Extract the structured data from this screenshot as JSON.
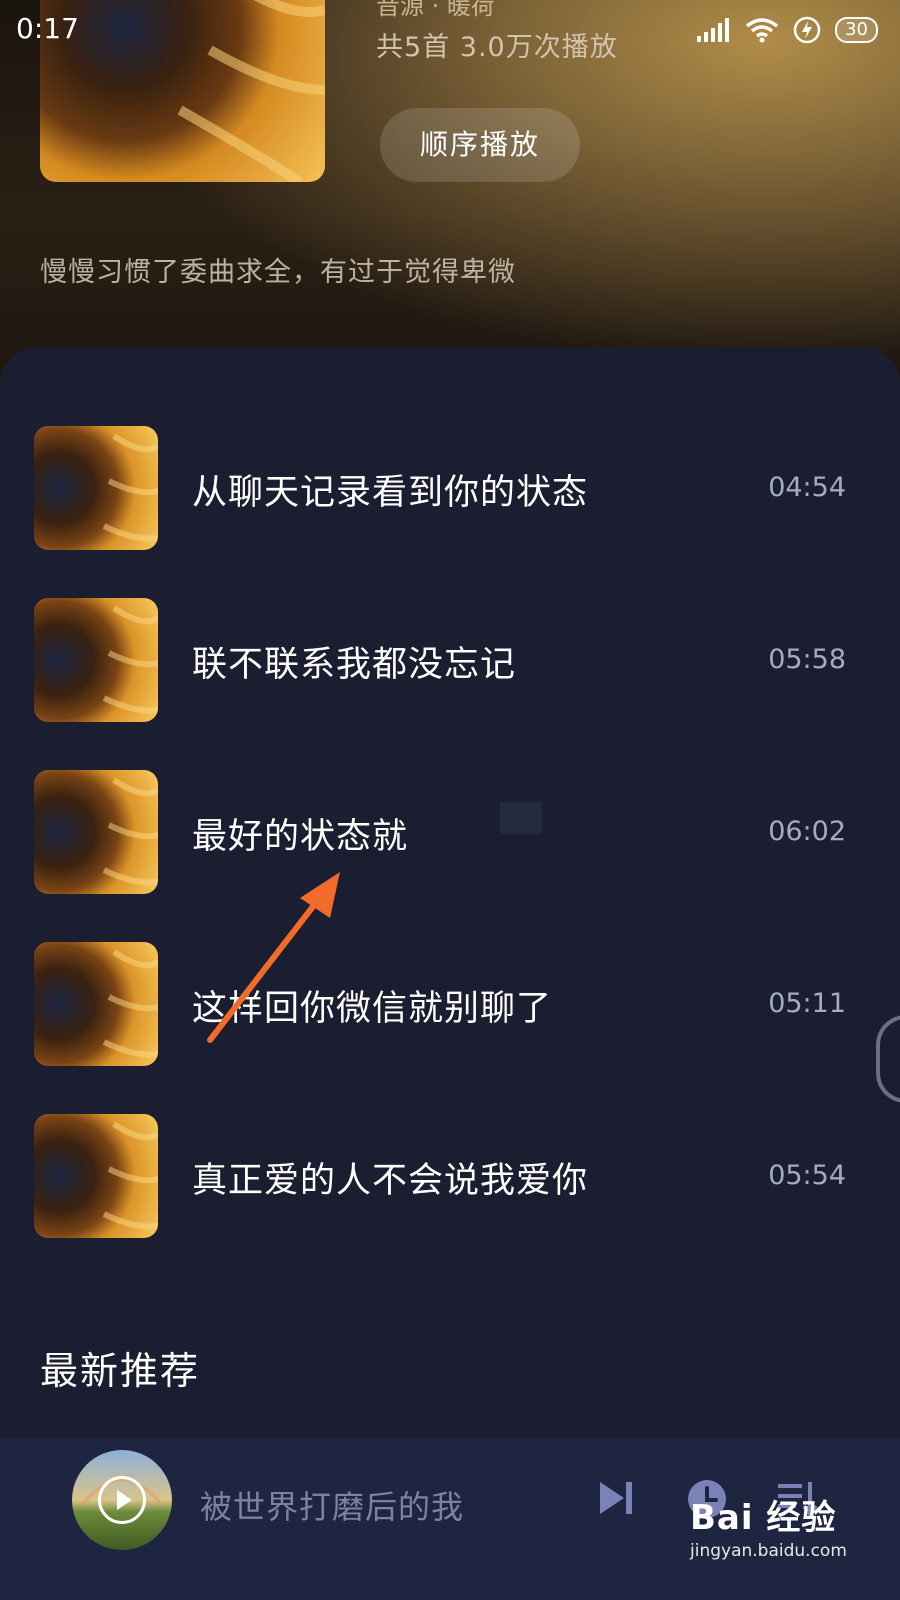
{
  "status_bar": {
    "time": "0:17",
    "battery": "30"
  },
  "playlist": {
    "source_line": "音源 · 暖荷",
    "count_text": "共5首   3.0万次播放",
    "play_order_label": "顺序播放",
    "tagline": "慢慢习惯了委曲求全，有过于觉得卑微"
  },
  "songs": [
    {
      "title": "从聊天记录看到你的状态",
      "duration": "04:54"
    },
    {
      "title": "联不联系我都没忘记",
      "duration": "05:58"
    },
    {
      "title": "最好的状态就",
      "duration": "06:02"
    },
    {
      "title": "这样回你微信就别聊了",
      "duration": "05:11"
    },
    {
      "title": "真正爱的人不会说我爱你",
      "duration": "05:54"
    }
  ],
  "section_title": "最新推荐",
  "player": {
    "title": "被世界打磨后的我"
  },
  "watermark": {
    "main": "Bai 经验",
    "sub": "jingyan.baidu.com"
  },
  "colors": {
    "sheet_bg": "#1a1e30",
    "player_bg": "#1e2541",
    "arrow": "#f26b2a",
    "icon": "#7b82b8"
  },
  "icons": [
    "signal-icon",
    "wifi-icon",
    "charging-icon",
    "battery-icon",
    "next-track-icon",
    "timer-icon",
    "playlist-icon",
    "play-icon"
  ]
}
